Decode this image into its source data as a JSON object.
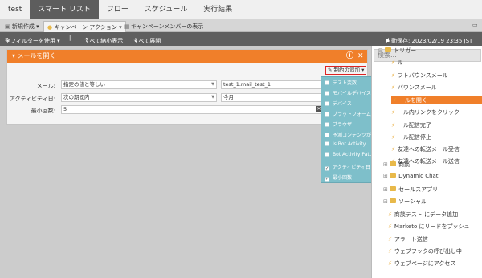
{
  "tabs": [
    "test",
    "スマート リスト",
    "フロー",
    "スケジュール",
    "実行結果"
  ],
  "subtabs": [
    "新規作成 ▾",
    "キャンペーン アクション ▾",
    "キャンペーンメンバーの表示"
  ],
  "toolbar": {
    "filter_use": "全フィルターを使用 ▾",
    "sep": "|",
    "collapse_all": "すべて縮小表示",
    "expand_all": "すべて展開",
    "autosave": "自動保存: 2023/02/19 23:35 JST"
  },
  "dialog": {
    "title": "メールを開く",
    "add_constraint": "制約の追加 ▾",
    "rows": [
      {
        "label": "メール:",
        "operator": "指定の値と等しい",
        "value": "test_1.mail_test_1"
      },
      {
        "label": "アクティビティ日:",
        "operator": "次の期間内",
        "value": "今月"
      },
      {
        "label": "最小回数:",
        "operator": "5"
      }
    ]
  },
  "dropdown": [
    {
      "label": "テスト変数",
      "checked": false
    },
    {
      "label": "モバイルデバイスです",
      "checked": false
    },
    {
      "label": "デバイス",
      "checked": false
    },
    {
      "label": "プラットフォーム",
      "checked": false
    },
    {
      "label": "ブラウザ",
      "checked": false
    },
    {
      "label": "予測コンテンツがあります",
      "checked": false
    },
    {
      "label": "Is Bot Activity",
      "checked": false
    },
    {
      "label": "Bot Activity Pattern",
      "checked": false
    },
    {
      "label": "アクティビティ日",
      "checked": true
    },
    {
      "label": "最小回数",
      "checked": true
    }
  ],
  "right_panel": {
    "search_placeholder": "検索...",
    "items": [
      {
        "label": "トリガー",
        "type": "folder"
      },
      {
        "label": "ル",
        "type": "trigger"
      },
      {
        "label": "フトバウンスメール",
        "type": "trigger"
      },
      {
        "label": "バウンスメール",
        "type": "trigger"
      },
      {
        "label": "ールを開く",
        "type": "trigger",
        "selected": true
      },
      {
        "label": "ール内リンクをクリック",
        "type": "trigger"
      },
      {
        "label": "ール配信完了",
        "type": "trigger"
      },
      {
        "label": "ール配信停止",
        "type": "trigger"
      },
      {
        "label": "友達への転送メール受信",
        "type": "trigger"
      },
      {
        "label": "友達への転送メール送信",
        "type": "trigger"
      },
      {
        "label": "商談",
        "type": "folder"
      },
      {
        "label": "Dynamic Chat",
        "type": "folder"
      },
      {
        "label": "セールスアプリ",
        "type": "folder"
      },
      {
        "label": "ソーシャル",
        "type": "folder"
      },
      {
        "label": "商談テスト にデータ追加",
        "type": "trigger"
      },
      {
        "label": "Marketo にリードをプッシュ",
        "type": "trigger"
      },
      {
        "label": "アラート送信",
        "type": "trigger"
      },
      {
        "label": "ウェブフックの呼び出し中",
        "type": "trigger"
      },
      {
        "label": "ウェブページにアクセス",
        "type": "trigger"
      }
    ]
  }
}
